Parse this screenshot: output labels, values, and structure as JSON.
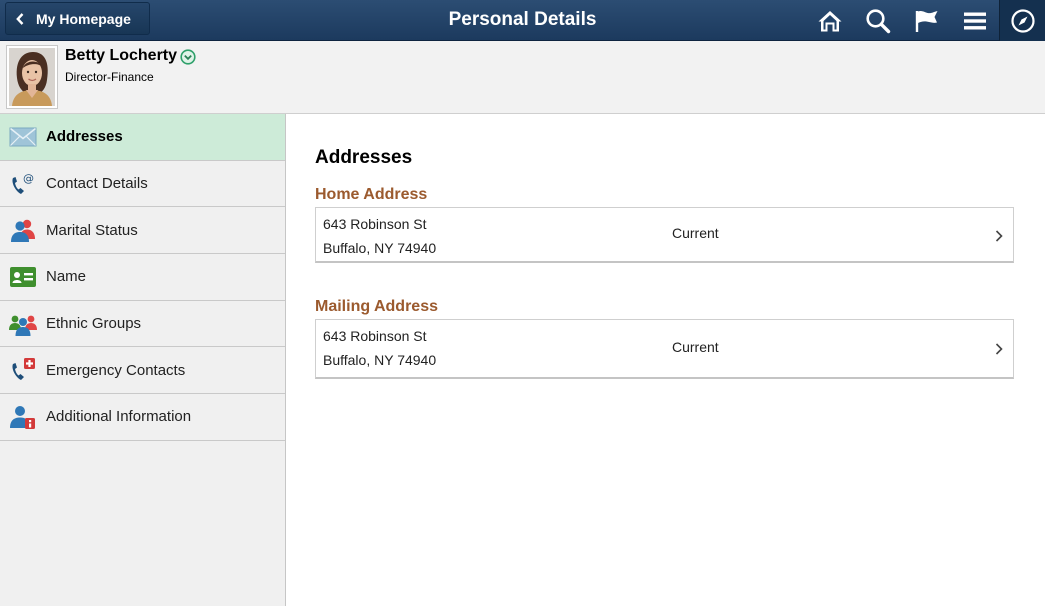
{
  "topbar": {
    "back_label": "My Homepage",
    "title": "Personal Details",
    "icons": [
      "home-icon",
      "search-icon",
      "flag-icon",
      "menu-icon",
      "compass-icon"
    ],
    "bg_color": "#22446b"
  },
  "employee": {
    "name": "Betty Locherty",
    "job_title": "Director-Finance",
    "status_icon": "check-circle-icon",
    "status_color": "#2ea06a"
  },
  "sidebar": {
    "active_color": "#cdebd8",
    "items": [
      {
        "label": "Addresses",
        "icon": "envelope-icon",
        "active": true
      },
      {
        "label": "Contact Details",
        "icon": "phone-at-icon",
        "active": false
      },
      {
        "label": "Marital Status",
        "icon": "couple-icon",
        "active": false
      },
      {
        "label": "Name",
        "icon": "id-card-icon",
        "active": false
      },
      {
        "label": "Ethnic Groups",
        "icon": "group-icon",
        "active": false
      },
      {
        "label": "Emergency Contacts",
        "icon": "phone-emergency-icon",
        "active": false
      },
      {
        "label": "Additional Information",
        "icon": "person-info-icon",
        "active": false
      }
    ]
  },
  "main": {
    "section_title": "Addresses",
    "addresses": [
      {
        "heading": "Home Address",
        "line1": "643 Robinson St",
        "line2": "Buffalo, NY 74940",
        "status": "Current"
      },
      {
        "heading": "Mailing Address",
        "line1": "643 Robinson St",
        "line2": "Buffalo, NY 74940",
        "status": "Current"
      }
    ],
    "heading_color": "#9b5a2e"
  }
}
